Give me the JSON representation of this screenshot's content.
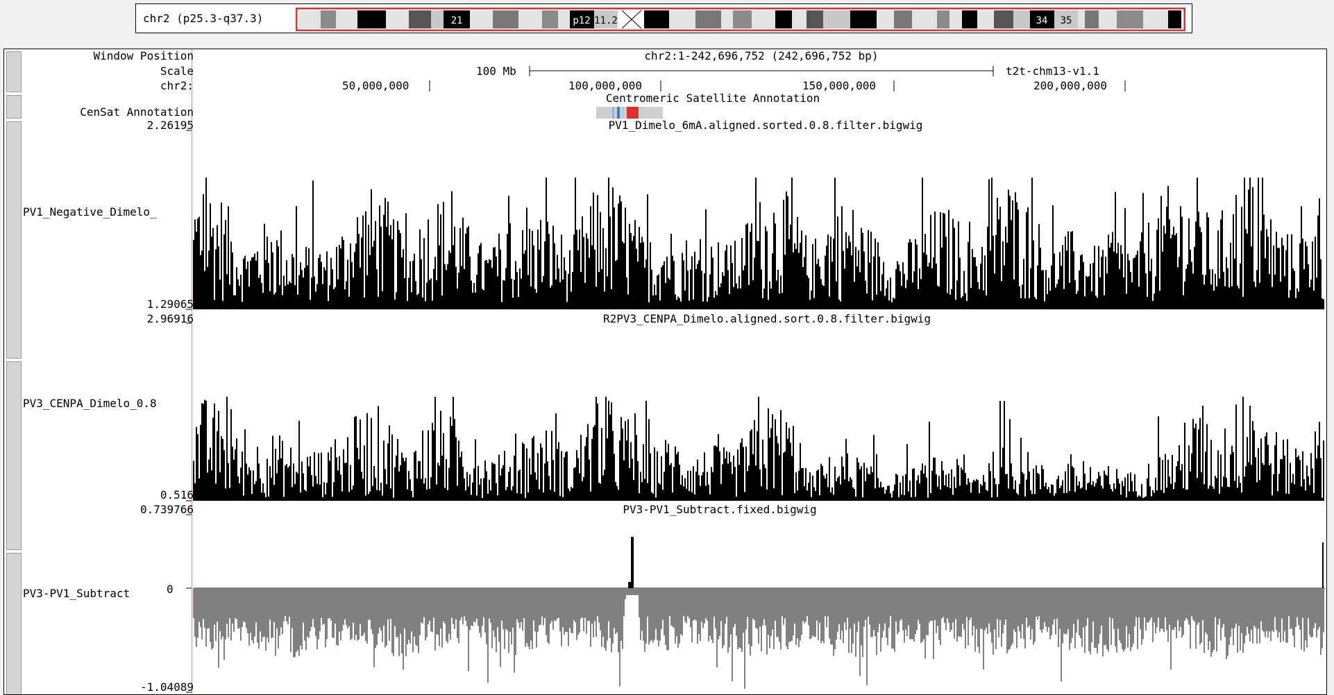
{
  "ideogram": {
    "label": "chr2 (p25.3-q37.3)",
    "band_labels": [
      "21",
      "p12",
      "11.2",
      "34",
      "35"
    ]
  },
  "header": {
    "window_position_label": "Window Position",
    "scale_label": "Scale",
    "chrom_label": "chr2:",
    "position_text": "chr2:1-242,696,752 (242,696,752 bp)",
    "scale_text": "100 Mb",
    "assembly": "t2t-chm13-v1.1",
    "ruler_ticks": [
      "50,000,000",
      "100,000,000",
      "150,000,000",
      "200,000,000"
    ]
  },
  "censat": {
    "side_label": "CenSat Annotation",
    "title": "Centromeric Satellite Annotation"
  },
  "tracks": [
    {
      "side_label": "PV1_Negative_Dimelo_",
      "title": "PV1_Dimelo_6mA.aligned.sorted.0.8.filter.bigwig",
      "max": "2.26195",
      "min": "1.29065",
      "color": "#000000"
    },
    {
      "side_label": "PV3_CENPA_Dimelo_0.8",
      "title": "R2PV3_CENPA_Dimelo.aligned.sort.0.8.filter.bigwig",
      "max": "2.96916",
      "min": "0.516",
      "color": "#000000"
    },
    {
      "side_label": "PV3-PV1_Subtract",
      "title": "PV3-PV1_Subtract.fixed.bigwig",
      "max": "0.739766",
      "zero": "0",
      "min": "-1.04089",
      "color": "#808080",
      "peak_color": "#000000"
    }
  ],
  "colors": {
    "highlight": "#e0302a",
    "left_edge": "#ff8080",
    "side_button": "#d4d4d4"
  }
}
